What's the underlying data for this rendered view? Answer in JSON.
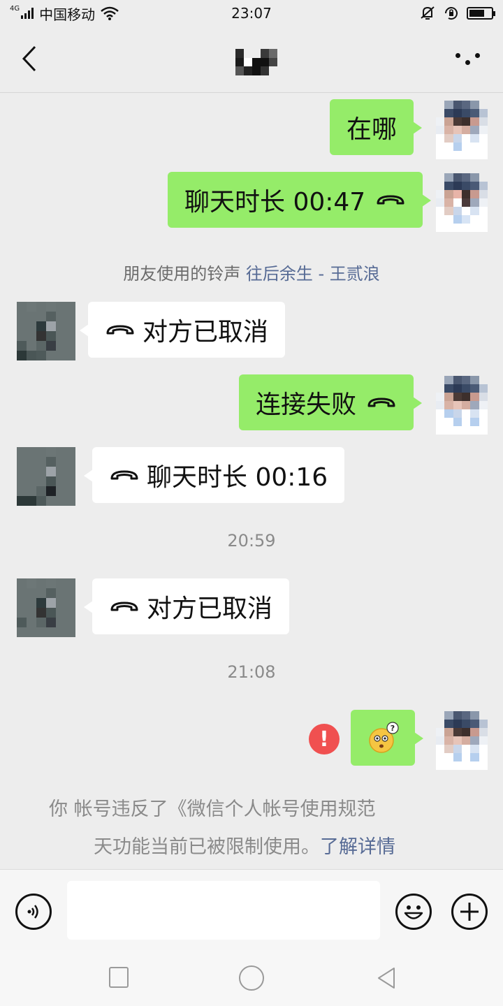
{
  "status_bar": {
    "network": "4G",
    "carrier": "中国移动",
    "time": "23:07"
  },
  "chat": {
    "messages": [
      {
        "from": "self",
        "text": "在哪"
      },
      {
        "from": "self",
        "text": "聊天时长 00:47",
        "icon": "phone-hangup-icon"
      },
      {
        "type": "system",
        "prefix": "朋友使用的铃声",
        "link": "往后余生 - 王贰浪"
      },
      {
        "from": "other",
        "text": "对方已取消",
        "icon": "phone-hangup-icon"
      },
      {
        "from": "self",
        "text": "连接失败",
        "icon": "phone-hangup-icon"
      },
      {
        "from": "other",
        "text": "聊天时长 00:16",
        "icon": "phone-hangup-icon"
      },
      {
        "type": "time",
        "text": "20:59"
      },
      {
        "from": "other",
        "text": "对方已取消",
        "icon": "phone-hangup-icon"
      },
      {
        "type": "time",
        "text": "21:08"
      },
      {
        "from": "self",
        "sticker": "confused-emoji",
        "status": "failed",
        "status_text": "!"
      }
    ],
    "restriction_notice": {
      "line1": "你 帐号违反了《微信个人帐号使用规范",
      "line2": "天功能当前已被限制使用。",
      "link": "了解详情"
    }
  },
  "input_bar": {
    "placeholder": ""
  },
  "colors": {
    "self_bubble": "#95ec69",
    "other_bubble": "#ffffff",
    "link": "#576b95",
    "error": "#f05050",
    "background": "#ededed"
  }
}
